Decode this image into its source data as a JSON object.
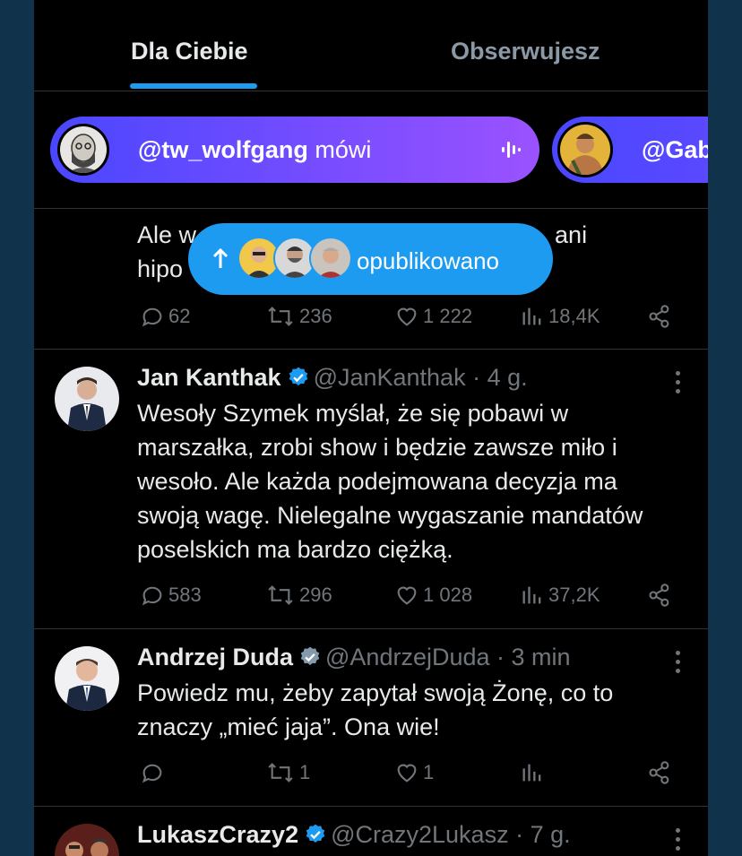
{
  "tabs": {
    "for_you": "Dla Ciebie",
    "following": "Obserwujesz"
  },
  "spaces": [
    {
      "handle": "@tw_wolfgang",
      "status": "mówi"
    },
    {
      "handle": "@Gab"
    }
  ],
  "toast": {
    "label": "opublikowano"
  },
  "tweets": [
    {
      "text_line1_a": "Ale w",
      "text_line1_b": "ani",
      "text_line2": "hipo",
      "stats": {
        "replies": "62",
        "reposts": "236",
        "likes": "1 222",
        "views": "18,4K"
      }
    },
    {
      "name": "Jan Kanthak",
      "handle": "@JanKanthak · 4 g.",
      "text": "Wesoły Szymek myślał, że się pobawi w marszałka, zrobi show i będzie zawsze miło i wesoło. Ale każda podejmowana decyzja ma swoją wagę. Nielegalne wygaszanie mandatów poselskich ma bardzo ciężką.",
      "stats": {
        "replies": "583",
        "reposts": "296",
        "likes": "1 028",
        "views": "37,2K"
      }
    },
    {
      "name": "Andrzej Duda",
      "handle": "@AndrzejDuda · 3 min",
      "text": "Powiedz mu, żeby zapytał swoją Żonę, co to znaczy „mieć jaja”. Ona wie!",
      "stats": {
        "replies": "",
        "reposts": "1",
        "likes": "1",
        "views": ""
      }
    },
    {
      "name": "LukaszCrazy2",
      "handle": "@Crazy2Lukasz · 7 g."
    }
  ],
  "colors": {
    "accent": "#1d9bf0",
    "verified_gold": "#1d9bf0",
    "verified_gray": "#829aab"
  }
}
